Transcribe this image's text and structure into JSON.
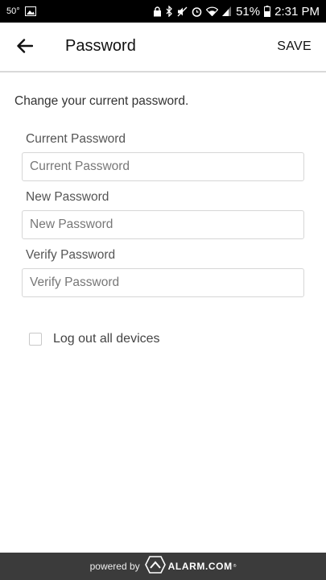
{
  "status_bar": {
    "temperature": "50°",
    "battery_percent": "51%",
    "time": "2:31 PM"
  },
  "header": {
    "title": "Password",
    "save_label": "SAVE",
    "back_icon": "arrow-left-icon"
  },
  "intro_text": "Change your current password.",
  "fields": [
    {
      "label": "Current Password",
      "placeholder": "Current Password",
      "value": ""
    },
    {
      "label": "New Password",
      "placeholder": "New Password",
      "value": ""
    },
    {
      "label": "Verify Password",
      "placeholder": "Verify Password",
      "value": ""
    }
  ],
  "logout_all": {
    "label": "Log out all devices",
    "checked": false
  },
  "footer": {
    "powered_by": "powered by",
    "brand": "ALARM.COM"
  },
  "colors": {
    "status_bar": "#000000",
    "footer": "#3b3b3b",
    "divider": "#d9d9d9"
  }
}
